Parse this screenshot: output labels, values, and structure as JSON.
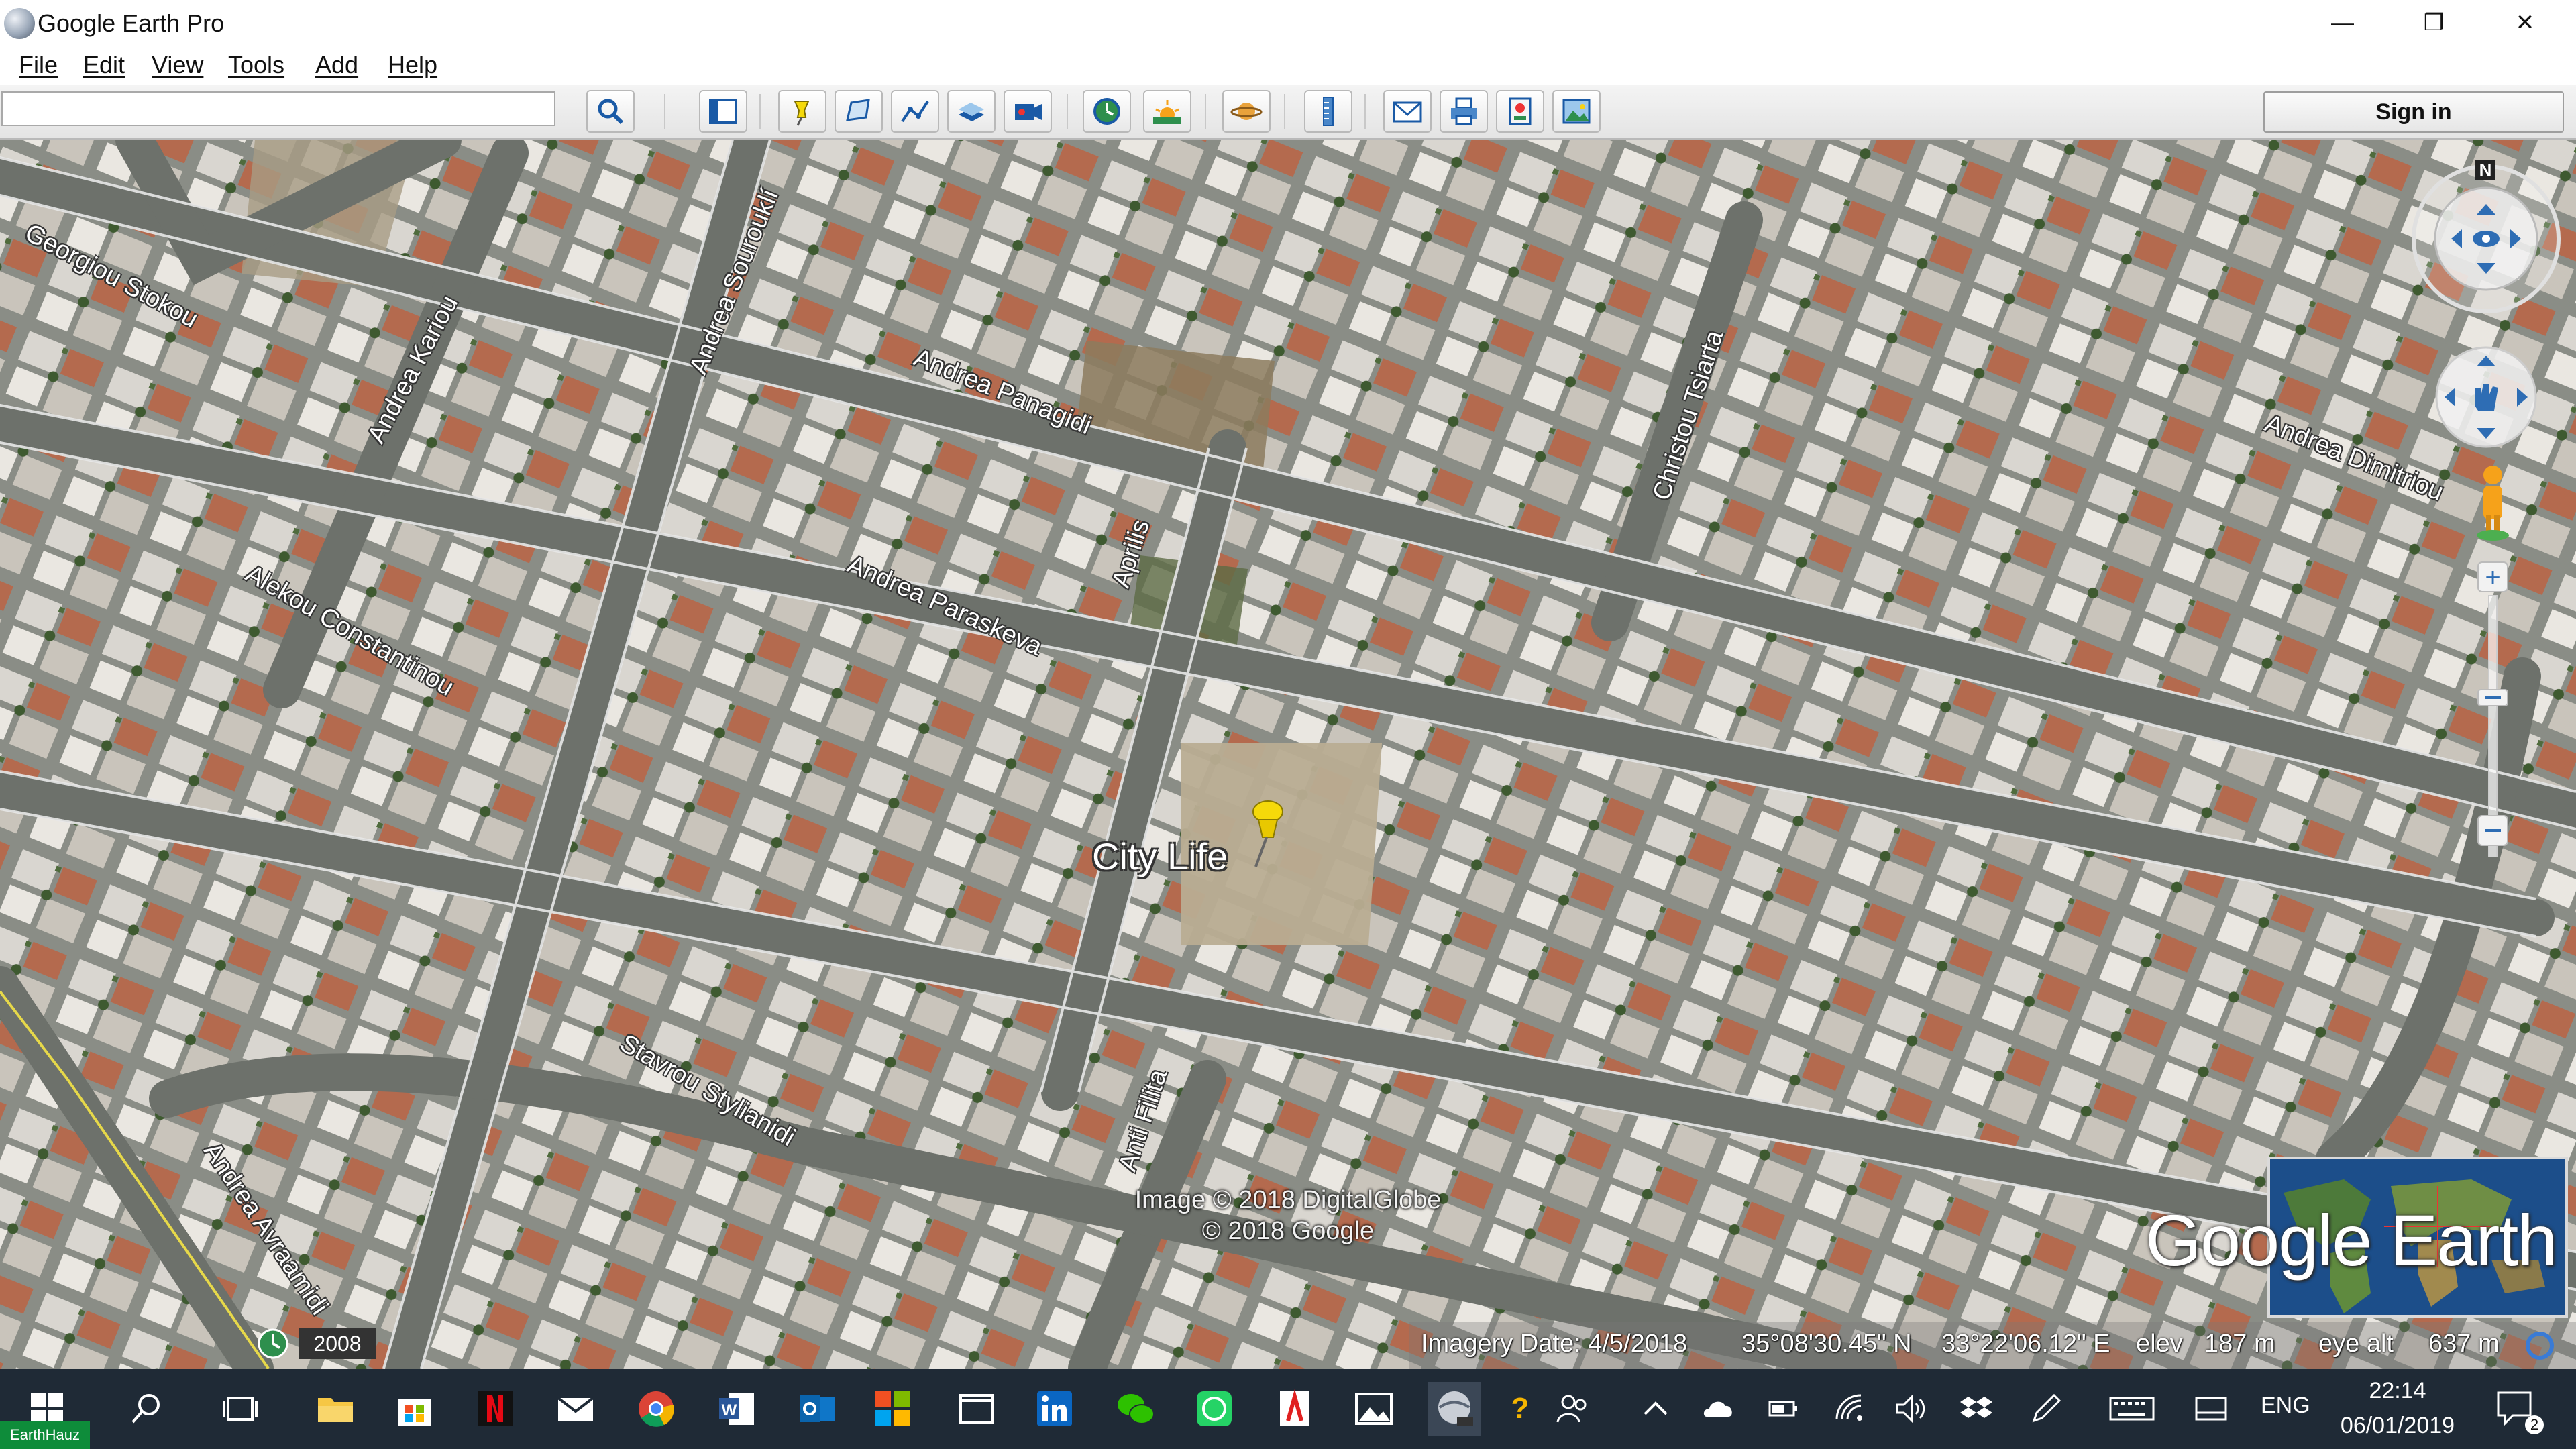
{
  "window": {
    "title": "Google Earth Pro",
    "minimize_symbol": "—",
    "maximize_symbol": "❐",
    "close_symbol": "✕"
  },
  "menu": {
    "items": [
      "File",
      "Edit",
      "View",
      "Tools",
      "Add",
      "Help"
    ]
  },
  "toolbar": {
    "search_value": "",
    "sign_in_label": "Sign in",
    "icons": [
      "search-icon",
      "sidebar-icon",
      "placemark-icon",
      "polygon-icon",
      "path-icon",
      "image-overlay-icon",
      "record-tour-icon",
      "historical-imagery-icon",
      "sunlight-icon",
      "planets-icon",
      "ruler-icon",
      "email-icon",
      "print-icon",
      "save-image-icon",
      "view-in-maps-icon"
    ]
  },
  "map": {
    "streets": [
      "Georgiou Stokou",
      "Andrea Kariou",
      "Andrea Sourouklí",
      "Andrea Panagidi",
      "Christou Tsiarta",
      "Andrea Dimitriou",
      "Aprilis",
      "Andrea Paraskeva",
      "Alekou Constantinou",
      "Stavrou Stylianidi",
      "Anti Filita",
      "Andrea Avraamidi"
    ],
    "placemark_label": "City Life",
    "credit_line1": "Image © 2018 DigitalGlobe",
    "credit_line2": "© 2018 Google",
    "logo_text": "Google Earth",
    "compass_label": "N",
    "historical_year": "2008"
  },
  "status": {
    "imagery_date": "Imagery Date: 4/5/2018",
    "latitude": "35°08'30.45\" N",
    "longitude": "33°22'06.12\" E",
    "elev_label": "elev",
    "elev_value": "187 m",
    "eye_alt_label": "eye alt",
    "eye_alt_value": "637 m"
  },
  "taskbar": {
    "language": "ENG",
    "time": "22:14",
    "date": "06/01/2019",
    "notification_count": "2",
    "watermark": "EarthHauz"
  },
  "colors": {
    "taskbar_bg": "#1f2a36",
    "road": "#6d716b",
    "road_edge": "#e8e8e8",
    "placemark": "#f5d90a"
  }
}
